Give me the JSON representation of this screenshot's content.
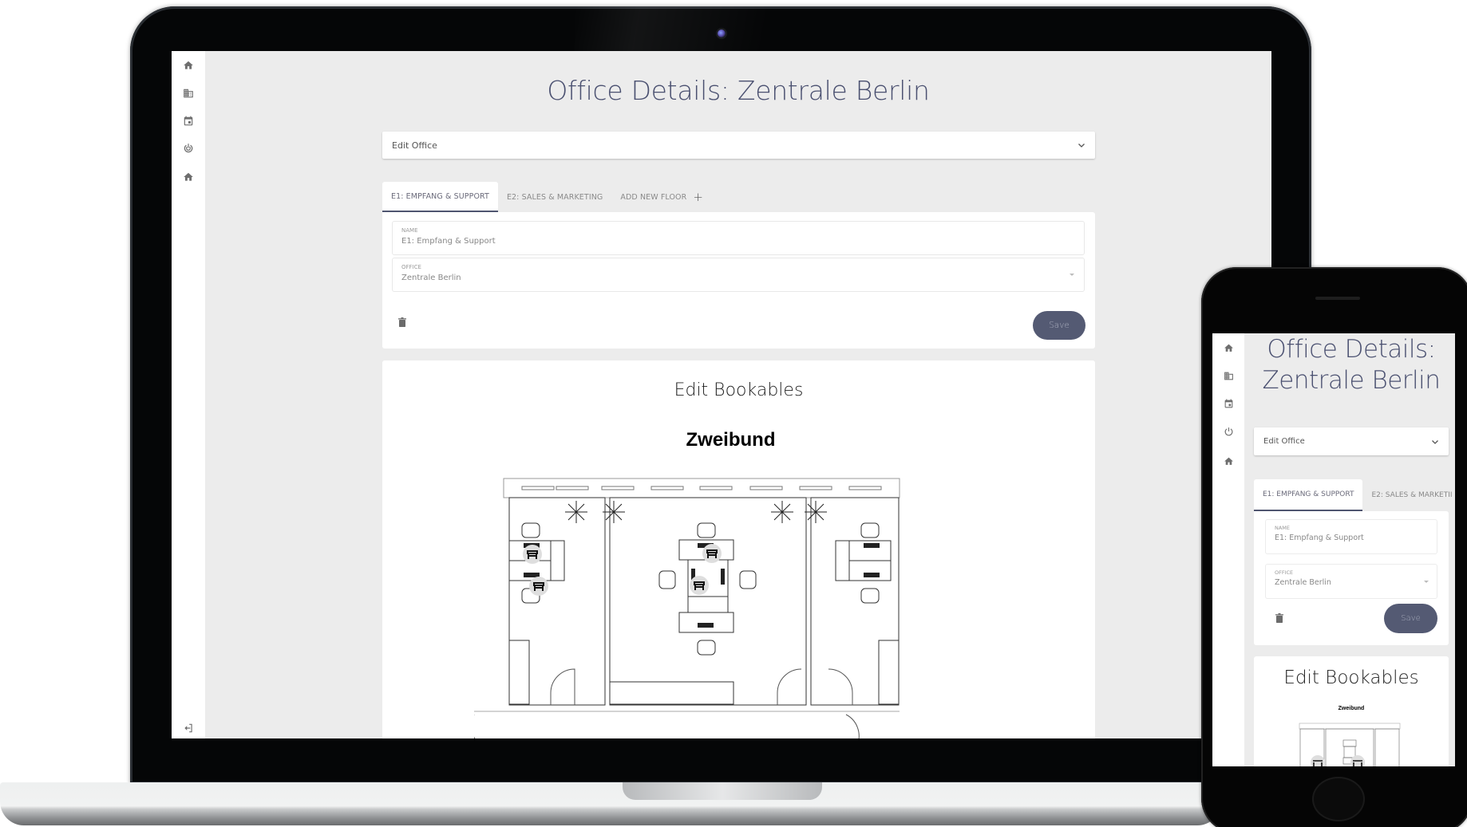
{
  "app": {
    "page_title": "Office Details: Zentrale Berlin",
    "sidebar": {
      "items": [
        {
          "icon": "home-icon",
          "label": "Home"
        },
        {
          "icon": "building-icon",
          "label": "Offices"
        },
        {
          "icon": "calendar-icon",
          "label": "Bookings"
        },
        {
          "icon": "power-target-icon",
          "label": "Status"
        },
        {
          "icon": "home-icon",
          "label": "Home"
        }
      ],
      "logout_icon": "logout-icon"
    },
    "edit_office_dropdown": {
      "label": "Edit Office",
      "icon": "chevron-down-icon"
    },
    "floor_tabs": [
      {
        "label": "E1: Empfang & Support",
        "active": true
      },
      {
        "label": "E2: Sales & Marketing",
        "active": false
      },
      {
        "label": "Add new floor",
        "active": false,
        "icon": "plus-icon"
      }
    ],
    "floor_form": {
      "name_label": "NAME",
      "name_value": "E1: Empfang  & Support",
      "office_label": "OFFICE",
      "office_value": "Zentrale Berlin",
      "delete_icon": "trash-icon",
      "save_label": "Save"
    },
    "bookables": {
      "title": "Edit Bookables",
      "floorplan_title": "Zweibund",
      "seat_markers": 4
    }
  },
  "phone": {
    "page_title_line1": "Office Details:",
    "page_title_line2": "Zentrale Berlin",
    "tab_truncated": "E2: SALES & MARKETII"
  },
  "colors": {
    "accent": "#545a73",
    "title": "#4a5070",
    "background": "#ececec",
    "card": "#ffffff"
  }
}
